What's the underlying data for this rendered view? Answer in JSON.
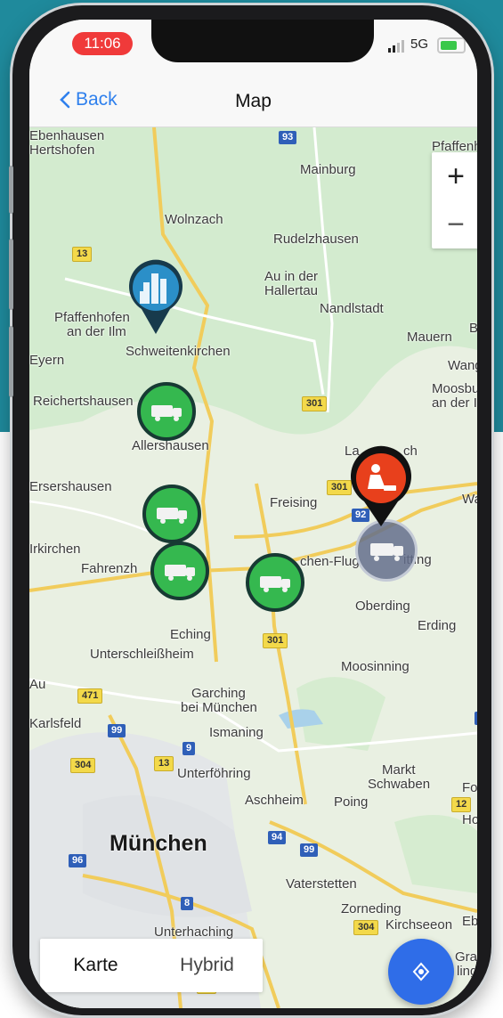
{
  "status_bar": {
    "time": "11:06",
    "network": "5G"
  },
  "nav": {
    "back_label": "Back",
    "title": "Map"
  },
  "map": {
    "places": [
      "Ebenhausen",
      "Hertshofen",
      "Mainburg",
      "Pfaffenh",
      "Wolnzach",
      "Rudelzhausen",
      "Au in der",
      "Hallertau",
      "Nandlstadt",
      "Pfaffenhofen",
      "an der Ilm",
      "Mauern",
      "B",
      "Eyern",
      "Schweitenkirchen",
      "Wang",
      "Moosburg",
      "an der Isar",
      "Reichertshausen",
      "Allershausen",
      "La",
      "ch",
      "Wa",
      "Ersershausen",
      "Freising",
      "Irkirchen",
      "Fahrenzh",
      "chen-Flug",
      "itting",
      "Oberding",
      "Erding",
      "Eching",
      "Unterschleißheim",
      "Moosinning",
      "Au",
      "Garching",
      "bei München",
      "Karlsfeld",
      "Ismaning",
      "Markt",
      "Schwaben",
      "Fo",
      "Unterföhring",
      "Aschheim",
      "Poing",
      "Ho",
      "München",
      "Vaterstetten",
      "Zorneding",
      "Kirchseeon",
      "Eber",
      "Unterhaching",
      "Grafin",
      "ling"
    ],
    "road_labels": [
      "93",
      "13",
      "301",
      "301",
      "92",
      "301",
      "471",
      "99",
      "304",
      "13",
      "9",
      "94",
      "12",
      "94",
      "99",
      "96",
      "8",
      "304",
      "13",
      "11"
    ]
  },
  "zoom": {
    "in": "+",
    "out": "−"
  },
  "markers": {
    "trucks_green": 4,
    "truck_gray": 1,
    "roadwork": 1,
    "city": 1
  },
  "map_type": {
    "karte": "Karte",
    "hybrid": "Hybrid"
  },
  "colors": {
    "accent": "#2f80ed",
    "truck": "#35b84f",
    "roadwork": "#e8401c",
    "fab": "#2f6de8"
  },
  "icons": [
    "chevron-left-icon",
    "truck-icon",
    "roadwork-icon",
    "city-icon",
    "locate-icon"
  ]
}
